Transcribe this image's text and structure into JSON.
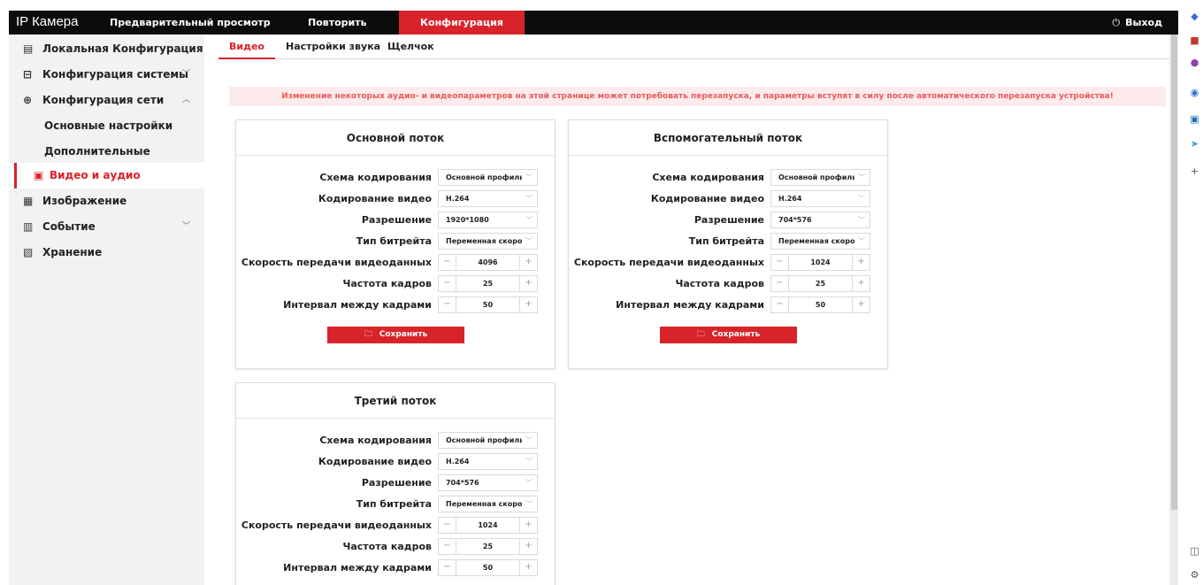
{
  "header": {
    "brand": "IP Камера",
    "nav": [
      "Предварительный просмотр",
      "Повторить",
      "Конфигурация"
    ],
    "logout": "Выход"
  },
  "sidebar": {
    "items": [
      {
        "label": "Локальная Конфигурация",
        "icon": "monitor-icon"
      },
      {
        "label": "Конфигурация системы",
        "icon": "system-config-icon",
        "chevron": "down"
      },
      {
        "label": "Конфигурация сети",
        "icon": "globe-icon",
        "chevron": "up"
      },
      {
        "label": "Основные настройки",
        "sub": true
      },
      {
        "label": "Дополнительные настройки",
        "sub": true
      },
      {
        "label": "Видео и аудио",
        "icon": "video-audio-icon",
        "active": true
      },
      {
        "label": "Изображение",
        "icon": "image-icon"
      },
      {
        "label": "Событие",
        "icon": "event-icon",
        "chevron": "down"
      },
      {
        "label": "Хранение",
        "icon": "storage-icon"
      }
    ]
  },
  "tabs": [
    "Видео",
    "Настройки звука",
    "Щелчок"
  ],
  "notice": "Изменение некоторых аудио- и видеопараметров на этой странице может потребовать перезапуска, и параметры вступят в силу после автоматического перезапуска устройства!",
  "labels": {
    "encoding_scheme": "Схема кодирования",
    "video_encoding": "Кодирование видео",
    "resolution": "Разрешение",
    "bitrate_type": "Тип битрейта",
    "bitrate": "Скорость передачи видеоданных",
    "frame_rate": "Частота кадров",
    "iframe_interval": "Интервал между кадрами",
    "save": "Сохранить"
  },
  "streams": [
    {
      "title": "Основной поток",
      "encoding_scheme": "Основной профиль",
      "video_encoding": "H.264",
      "resolution": "1920*1080",
      "bitrate_type": "Переменная скорость",
      "bitrate": "4096",
      "frame_rate": "25",
      "iframe_interval": "50"
    },
    {
      "title": "Вспомогательный поток",
      "encoding_scheme": "Основной профиль",
      "video_encoding": "H.264",
      "resolution": "704*576",
      "bitrate_type": "Переменная скорость",
      "bitrate": "1024",
      "frame_rate": "25",
      "iframe_interval": "50"
    },
    {
      "title": "Третий поток",
      "encoding_scheme": "Основной профиль",
      "video_encoding": "H.264",
      "resolution": "704*576",
      "bitrate_type": "Переменная скорость",
      "bitrate": "1024",
      "frame_rate": "25",
      "iframe_interval": "50"
    }
  ],
  "colors": {
    "accent": "#d9232b",
    "topbar": "#0c0c0c",
    "sidebar": "#f2f2f2",
    "notice_bg": "#fdeaea"
  }
}
